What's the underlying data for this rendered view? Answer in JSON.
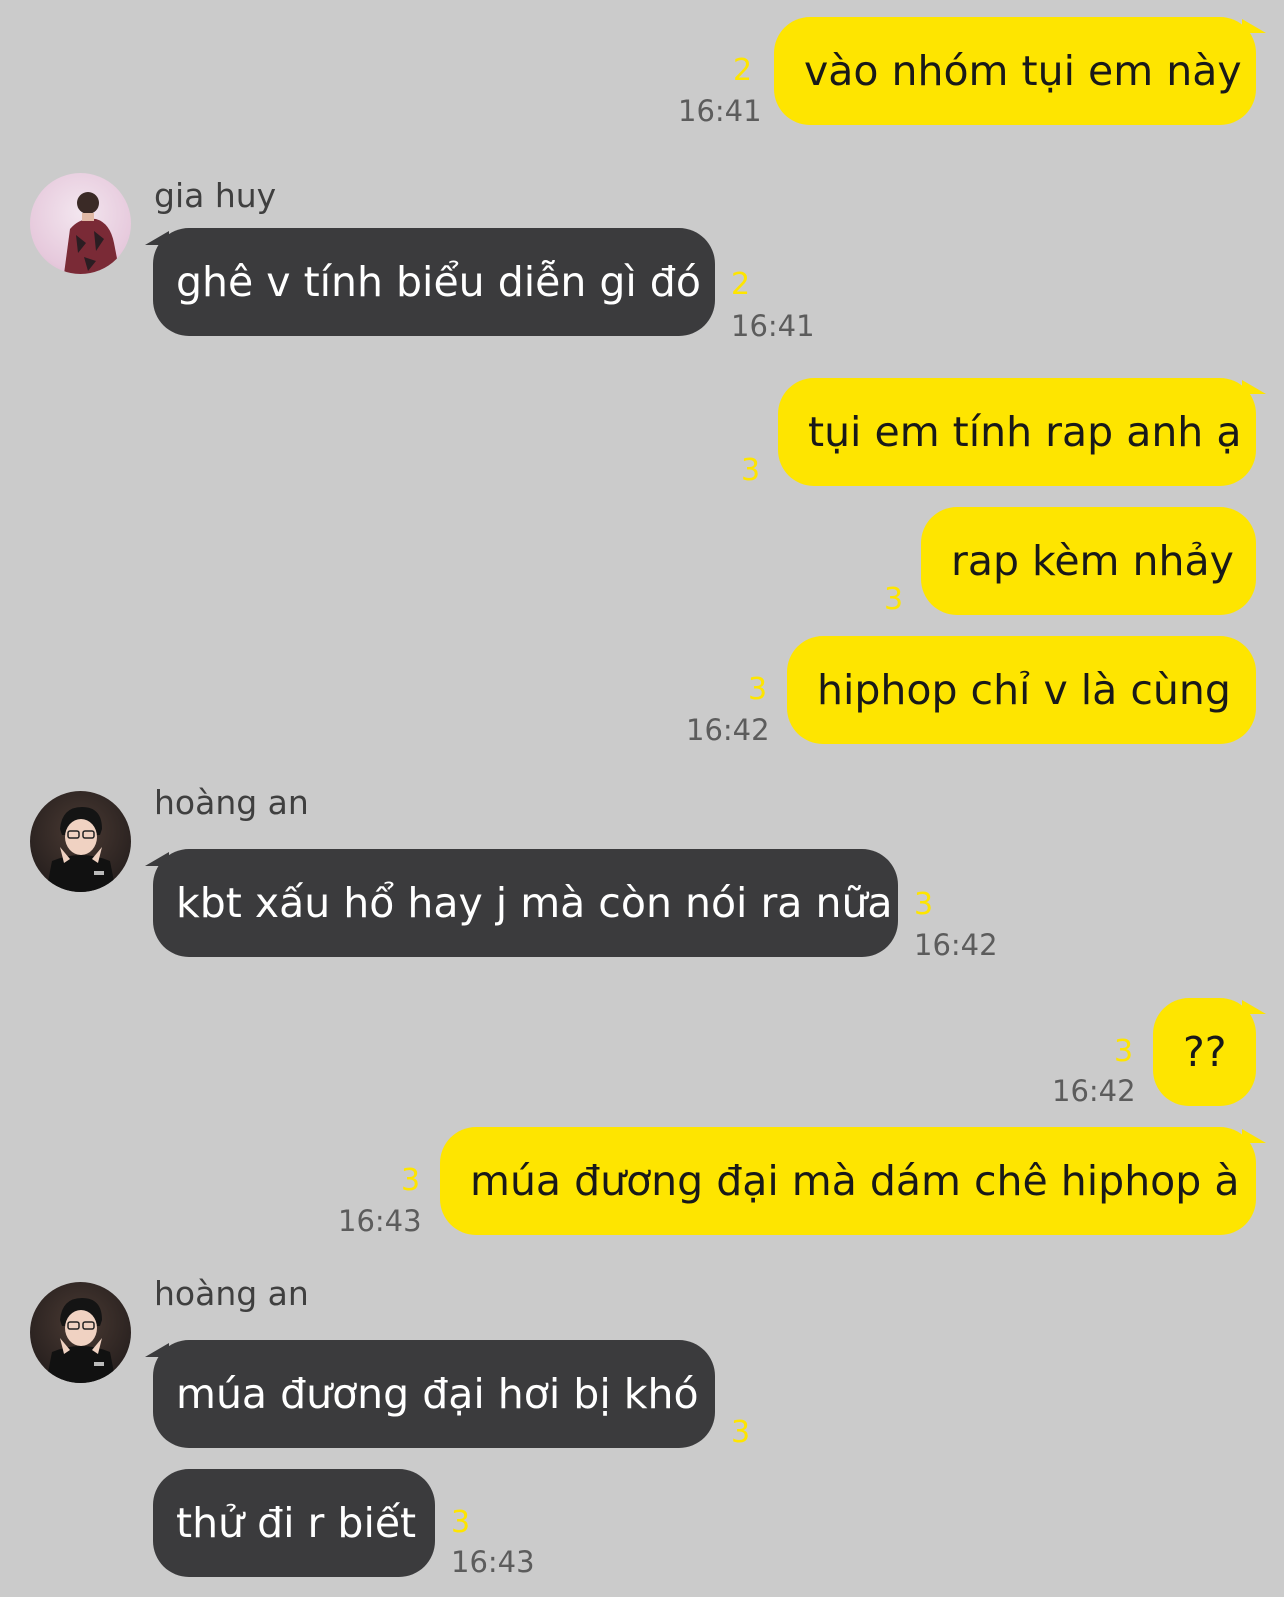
{
  "messages": [
    {
      "id": "m1",
      "side": "mine",
      "text": "vào nhóm tụi em này",
      "unread": "2",
      "time": "16:41"
    },
    {
      "id": "m2",
      "side": "theirs",
      "sender": "gia huy",
      "avatar": "person-avatar-gia-huy",
      "text": "ghê v tính biểu diễn gì đó",
      "unread": "2",
      "time": "16:41"
    },
    {
      "id": "m3",
      "side": "mine",
      "text": "tụi em tính rap anh ạ",
      "unread": "3"
    },
    {
      "id": "m4",
      "side": "mine",
      "text": "rap kèm nhảy",
      "unread": "3"
    },
    {
      "id": "m5",
      "side": "mine",
      "text": "hiphop chỉ v là cùng",
      "unread": "3",
      "time": "16:42"
    },
    {
      "id": "m6",
      "side": "theirs",
      "sender": "hoàng an",
      "avatar": "person-avatar-hoang-an",
      "text": "kbt xấu hổ hay j mà còn nói ra nữa",
      "unread": "3",
      "time": "16:42"
    },
    {
      "id": "m7",
      "side": "mine",
      "text": "??",
      "unread": "3",
      "time": "16:42"
    },
    {
      "id": "m8",
      "side": "mine",
      "text": "múa đương đại mà dám chê hiphop à",
      "unread": "3",
      "time": "16:43"
    },
    {
      "id": "m9",
      "side": "theirs",
      "sender": "hoàng an",
      "avatar": "person-avatar-hoang-an",
      "text": "múa đương đại hơi bị khó",
      "unread": "3"
    },
    {
      "id": "m10",
      "side": "theirs",
      "text": "thử đi r biết",
      "unread": "3",
      "time": "16:43"
    }
  ],
  "colors": {
    "background": "#cbcbcb",
    "mine_bubble": "#fee500",
    "theirs_bubble": "#3b3b3d",
    "unread_count": "#fee500",
    "timestamp": "#5c5c5c"
  }
}
